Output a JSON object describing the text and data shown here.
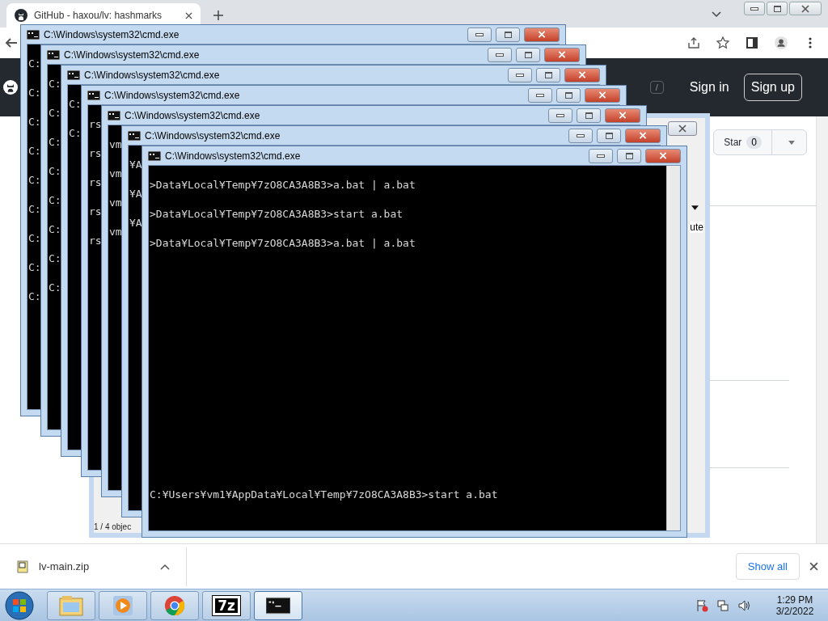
{
  "browser": {
    "tab_title": "GitHub - haxou/lv: hashmarks",
    "header": {
      "search_key": "/",
      "sign_in": "Sign in",
      "sign_up": "Sign up"
    },
    "repo": {
      "star": "Star",
      "star_count": "0"
    }
  },
  "archive_window": {
    "column_header": "ute",
    "status": "1 / 4 objec"
  },
  "console_windows": [
    {
      "title": "C:\\Windows\\system32\\cmd.exe",
      "lines": [
        "C:",
        "C:",
        "C:",
        "C:",
        "C:",
        "C:",
        "C:",
        "C:",
        "C:"
      ]
    },
    {
      "title": "C:\\Windows\\system32\\cmd.exe",
      "lines": [
        "C:",
        "C:",
        "C:",
        "C:",
        "C:",
        "C:",
        "C:",
        "C:"
      ]
    },
    {
      "title": "C:\\Windows\\system32\\cmd.exe",
      "lines": [
        "C:",
        "C:"
      ]
    },
    {
      "title": "C:\\Windows\\system32\\cmd.exe",
      "lines": [
        "rs",
        "rs",
        "rs",
        "rs",
        "rs"
      ]
    },
    {
      "title": "C:\\Windows\\system32\\cmd.exe",
      "lines": [
        "vm",
        "vm",
        "vm",
        "vm"
      ]
    },
    {
      "title": "C:\\Windows\\system32\\cmd.exe",
      "lines": [
        "¥A",
        "¥A",
        "¥A"
      ]
    },
    {
      "title": "C:\\Windows\\system32\\cmd.exe",
      "lines": [
        ">Data¥Local¥Temp¥7zO8CA3A8B3>a.bat | a.bat",
        ">Data¥Local¥Temp¥7zO8CA3A8B3>start a.bat",
        ">Data¥Local¥Temp¥7zO8CA3A8B3>a.bat | a.bat"
      ],
      "tail_lines": [
        "C:¥Users¥vm1¥AppData¥Local¥Temp¥7zO8CA3A8B3>start a.bat"
      ]
    }
  ],
  "downloads": {
    "file": "lv-main.zip",
    "show_all": "Show all"
  },
  "taskbar": {
    "apps": [
      {
        "kind": "explorer",
        "active": false
      },
      {
        "kind": "media",
        "active": false
      },
      {
        "kind": "chrome",
        "active": false
      },
      {
        "kind": "archiver",
        "label": "7z",
        "active": false
      },
      {
        "kind": "console",
        "active": true
      }
    ],
    "time": "1:29 PM",
    "date": "3/2/2022"
  }
}
